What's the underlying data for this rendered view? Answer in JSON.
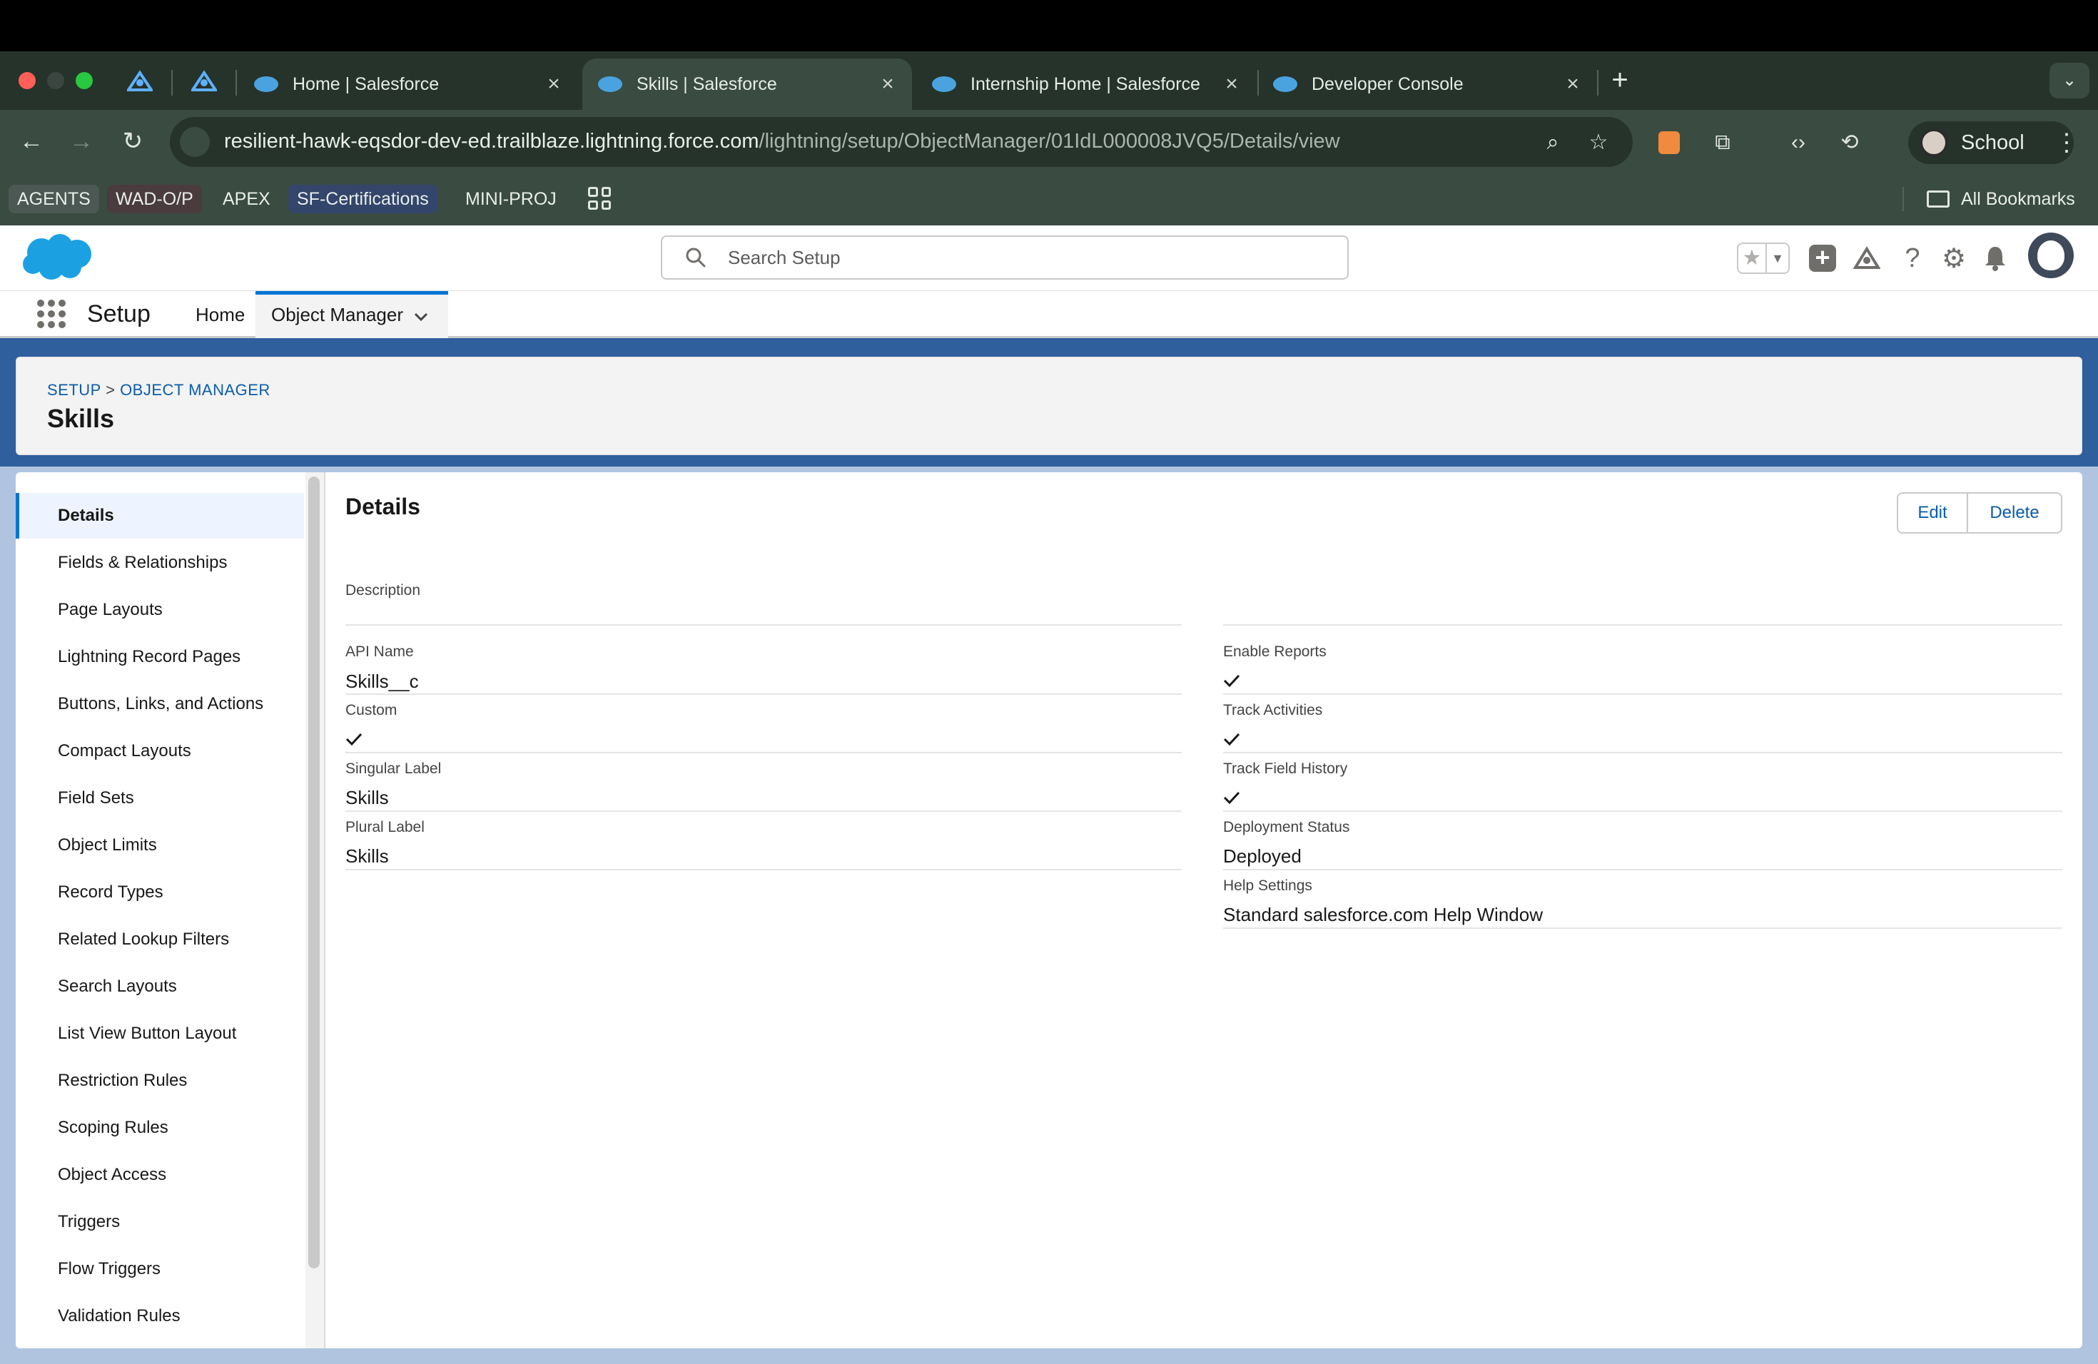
{
  "browser": {
    "tabs": [
      {
        "title": "Home | Salesforce"
      },
      {
        "title": "Skills | Salesforce"
      },
      {
        "title": "Internship Home | Salesforce"
      },
      {
        "title": "Developer Console"
      }
    ],
    "url_host": "resilient-hawk-eqsdor-dev-ed.trailblaze.lightning.force.com",
    "url_path": "/lightning/setup/ObjectManager/01IdL000008JVQ5/Details/view",
    "profile_name": "School",
    "bookmarks": [
      "AGENTS",
      "WAD-O/P",
      "APEX",
      "SF-Certifications",
      "MINI-PROJ"
    ],
    "all_bookmarks_label": "All Bookmarks"
  },
  "sf_header": {
    "search_placeholder": "Search Setup",
    "brand_color": "#1ba1e2"
  },
  "nav": {
    "app_name": "Setup",
    "items": [
      "Home",
      "Object Manager"
    ]
  },
  "page": {
    "breadcrumb": [
      "SETUP",
      "OBJECT MANAGER"
    ],
    "breadcrumb_sep": ">",
    "title": "Skills"
  },
  "sidebar": {
    "items": [
      "Details",
      "Fields & Relationships",
      "Page Layouts",
      "Lightning Record Pages",
      "Buttons, Links, and Actions",
      "Compact Layouts",
      "Field Sets",
      "Object Limits",
      "Record Types",
      "Related Lookup Filters",
      "Search Layouts",
      "List View Button Layout",
      "Restriction Rules",
      "Scoping Rules",
      "Object Access",
      "Triggers",
      "Flow Triggers",
      "Validation Rules"
    ],
    "active": "Details"
  },
  "details": {
    "title": "Details",
    "edit_label": "Edit",
    "delete_label": "Delete",
    "description_label": "Description",
    "left": [
      {
        "label": "API Name",
        "value": "Skills__c"
      },
      {
        "label": "Custom",
        "value": "checked"
      },
      {
        "label": "Singular Label",
        "value": "Skills"
      },
      {
        "label": "Plural Label",
        "value": "Skills"
      }
    ],
    "right": [
      {
        "label": "Enable Reports",
        "value": "checked"
      },
      {
        "label": "Track Activities",
        "value": "checked"
      },
      {
        "label": "Track Field History",
        "value": "checked"
      },
      {
        "label": "Deployment Status",
        "value": "Deployed"
      },
      {
        "label": "Help Settings",
        "value": "Standard salesforce.com Help Window"
      }
    ]
  }
}
